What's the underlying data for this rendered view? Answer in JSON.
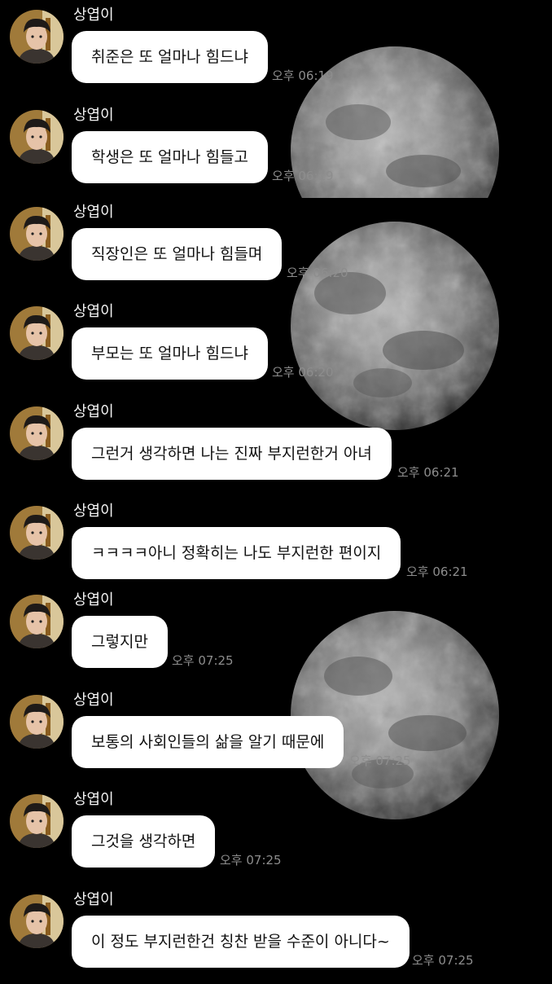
{
  "chat": {
    "messages": [
      {
        "sender": "상엽이",
        "text": "취준은 또 얼마나 힘드냐",
        "time": "오후 06:19"
      },
      {
        "sender": "상엽이",
        "text": "학생은 또 얼마나 힘들고",
        "time": "오후 06:19"
      },
      {
        "sender": "상엽이",
        "text": "직장인은 또 얼마나 힘들며",
        "time": "오후 06:20"
      },
      {
        "sender": "상엽이",
        "text": "부모는 또 얼마나 힘드냐",
        "time": "오후 06:20"
      },
      {
        "sender": "상엽이",
        "text": "그런거 생각하면 나는 진짜 부지런한거 아녀",
        "time": "오후 06:21"
      },
      {
        "sender": "상엽이",
        "text": "ㅋㅋㅋㅋ아니 정확히는 나도 부지런한 편이지",
        "time": "오후 06:21"
      },
      {
        "sender": "상엽이",
        "text": "그렇지만",
        "time": "오후 07:25"
      },
      {
        "sender": "상엽이",
        "text": "보통의 사회인들의 삶을 알기 때문에",
        "time": "오후 07:25"
      },
      {
        "sender": "상엽이",
        "text": "그것을 생각하면",
        "time": "오후 07:25"
      },
      {
        "sender": "상엽이",
        "text": "이 정도 부지런한건 칭찬 받을 수준이 아니다~",
        "time": "오후 07:25"
      }
    ]
  },
  "colors": {
    "background": "#000000",
    "bubble": "#ffffff",
    "bubble_text": "#111111",
    "sender_text": "#f2f2f2",
    "time_text": "#8d8d8d"
  },
  "icons": {
    "avatar": "profile-photo"
  }
}
